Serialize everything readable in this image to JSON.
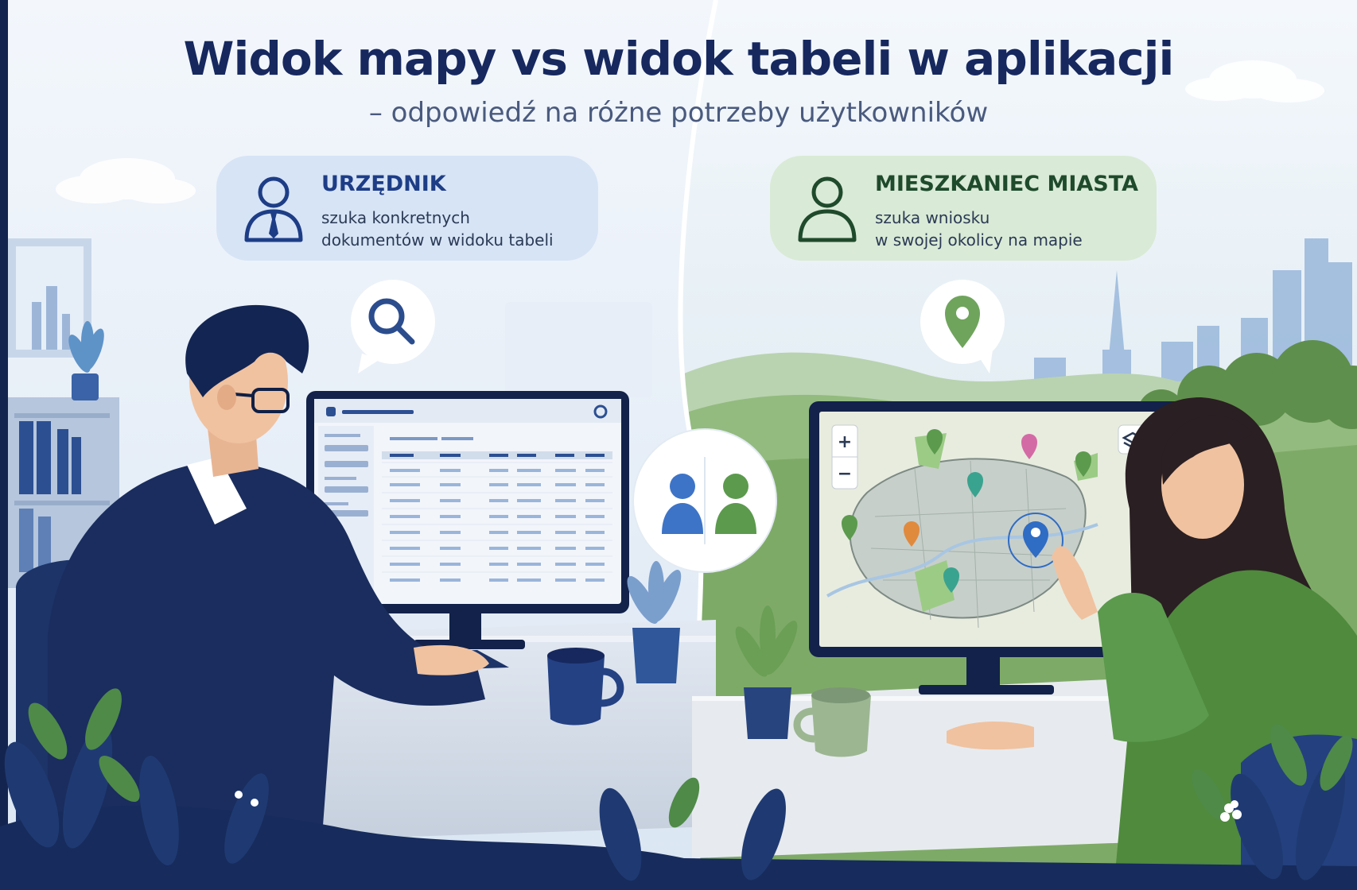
{
  "header": {
    "title": "Widok mapy vs widok tabeli w aplikacji",
    "subtitle": "– odpowiedź na różne potrzeby użytkowników"
  },
  "personas": [
    {
      "title": "URZĘDNIK",
      "description": "szuka konkretnych\ndokumentów w widoku tabeli",
      "icon": "user-with-tie-icon",
      "accent": "#1d3d86"
    },
    {
      "title": "MIESZKANIEC MIASTA",
      "description": "szuka wniosku\nw swojej okolicy na mapie",
      "icon": "user-icon",
      "accent": "#1f4a2c"
    }
  ],
  "icons": {
    "left_bubble": "search-icon",
    "right_bubble": "map-pin-icon",
    "center_badge": "two-users-icon"
  },
  "map_controls": {
    "zoom_in": "+",
    "zoom_out": "−"
  },
  "colors": {
    "navy": "#16285e",
    "blue_accent": "#2f6cc4",
    "green_accent": "#5c9a4e",
    "left_card_bg": "#d7e4f6",
    "right_card_bg": "#d9ead6"
  }
}
